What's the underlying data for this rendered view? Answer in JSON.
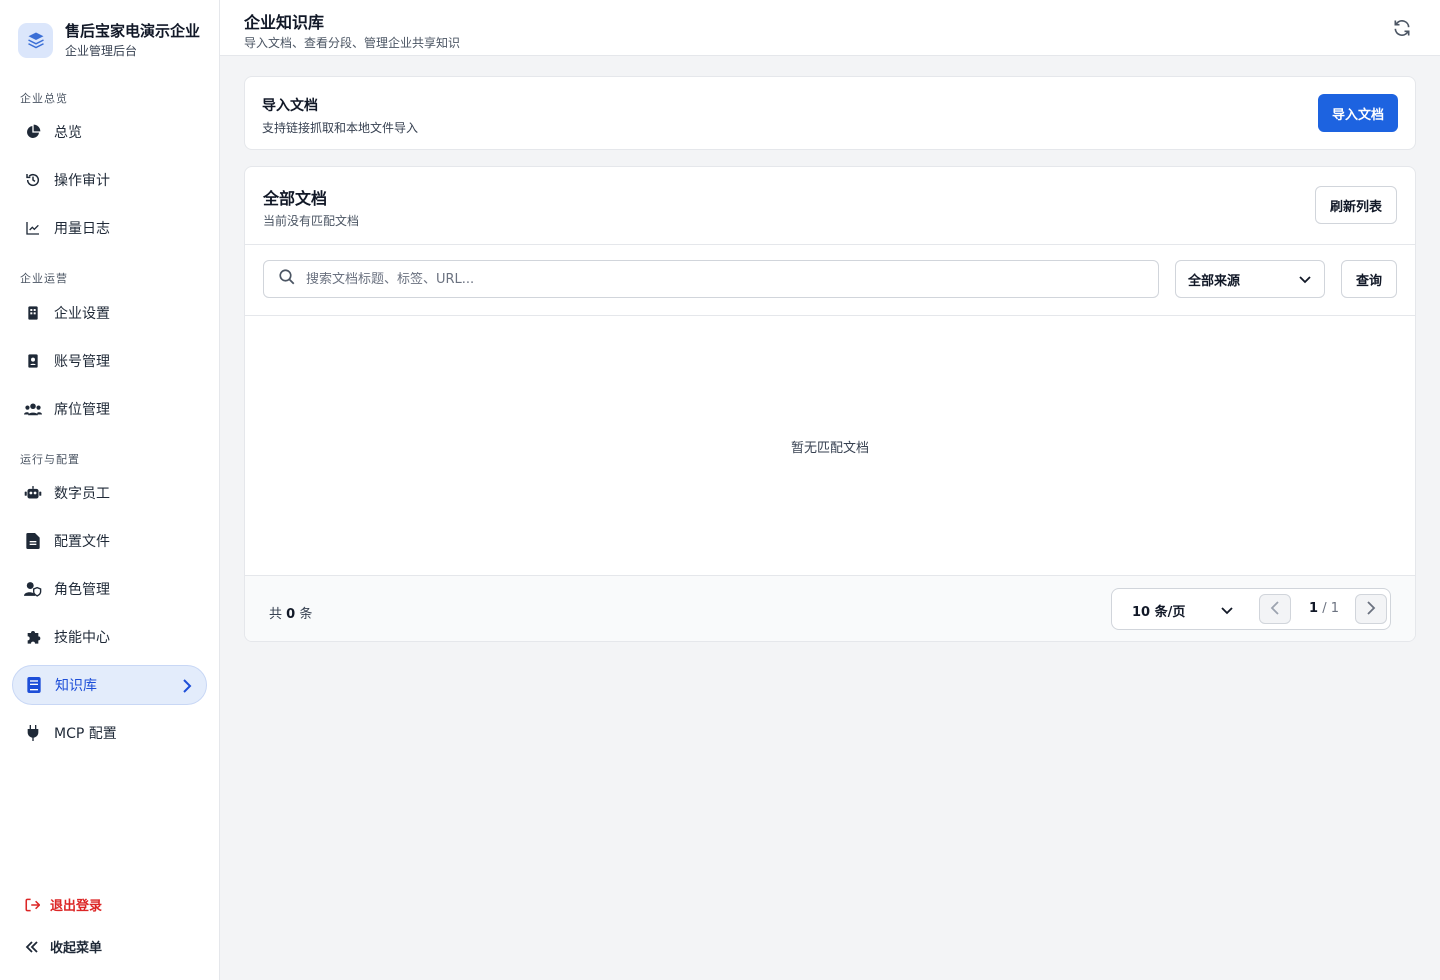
{
  "brand": {
    "name": "售后宝家电演示企业",
    "subtitle": "企业管理后台"
  },
  "sidebar": {
    "sections": [
      {
        "label": "企业总览"
      },
      {
        "label": "企业运营"
      },
      {
        "label": "运行与配置"
      }
    ],
    "items": [
      {
        "label": "总览",
        "icon": "pie-chart-icon"
      },
      {
        "label": "操作审计",
        "icon": "history-icon"
      },
      {
        "label": "用量日志",
        "icon": "line-chart-icon"
      },
      {
        "label": "企业设置",
        "icon": "building-icon"
      },
      {
        "label": "账号管理",
        "icon": "id-badge-icon"
      },
      {
        "label": "席位管理",
        "icon": "users-icon"
      },
      {
        "label": "数字员工",
        "icon": "robot-icon"
      },
      {
        "label": "配置文件",
        "icon": "file-icon"
      },
      {
        "label": "角色管理",
        "icon": "user-shield-icon"
      },
      {
        "label": "技能中心",
        "icon": "puzzle-icon"
      },
      {
        "label": "知识库",
        "icon": "book-icon",
        "active": true
      },
      {
        "label": "MCP 配置",
        "icon": "plug-icon"
      }
    ],
    "logout": "退出登录",
    "collapse": "收起菜单"
  },
  "header": {
    "title": "企业知识库",
    "subtitle": "导入文档、查看分段、管理企业共享知识"
  },
  "import_card": {
    "title": "导入文档",
    "subtitle": "支持链接抓取和本地文件导入",
    "button": "导入文档"
  },
  "docs_card": {
    "title": "全部文档",
    "subtitle": "当前没有匹配文档",
    "refresh_button": "刷新列表",
    "search_placeholder": "搜索文档标题、标签、URL...",
    "source_select": "全部来源",
    "query_button": "查询",
    "empty_text": "暂无匹配文档",
    "total_prefix": "共",
    "total_count": "0",
    "total_suffix": "条",
    "page_size": "10 条/页",
    "current_page": "1",
    "page_sep": "/",
    "total_pages": "1"
  },
  "colors": {
    "accent": "#1d63e0",
    "danger": "#dc2626",
    "active_bg": "#e3ecfb"
  }
}
